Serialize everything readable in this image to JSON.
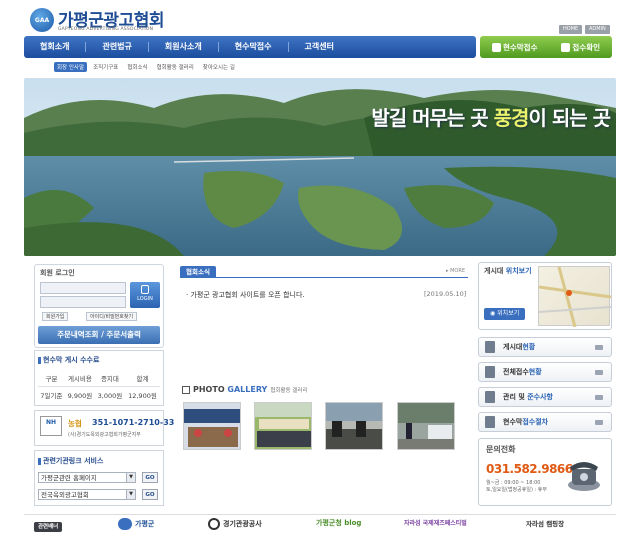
{
  "header": {
    "logo_mark": "GAA",
    "title": "가평군광고협회",
    "subtitle": "GAPYEONG ADVERTISING ASSOCIATION",
    "top_links": [
      "HOME",
      "ADMIN"
    ]
  },
  "nav": {
    "items": [
      "협회소개",
      "관련법규",
      "회원사소개",
      "현수막접수",
      "고객센터"
    ],
    "quick": [
      "현수막접수",
      "접수확인"
    ]
  },
  "sub_nav": [
    "회장 인사말",
    "조직기구표",
    "협회소식",
    "협회활동 갤러리",
    "찾아오시는 길"
  ],
  "banner": {
    "slogan_a": "발길 머무는 곳 ",
    "slogan_b": "풍경",
    "slogan_c": "이 되는 곳"
  },
  "login": {
    "title": "회원 로그인",
    "button": "LOGIN",
    "links": [
      "회원가입",
      "아이디/비밀번호찾기"
    ],
    "order_button": "주문내역조회 / 주문서출력"
  },
  "fee": {
    "title": "현수막 게시 수수료",
    "headers": [
      "구분",
      "게시비용",
      "증지대",
      "합계"
    ],
    "row": [
      "7일기준",
      "9,900원",
      "3,000원",
      "12,900원"
    ]
  },
  "bank": {
    "logo": "NH",
    "name": "농협",
    "account": "351-1071-2710-33",
    "holder": "(사)경기도옥외광고협회가평군지부"
  },
  "related": {
    "title": "관련기관링크 서비스",
    "selects": [
      "가평군관련 홈페이지",
      "전국옥외광고협회"
    ],
    "go": "GO"
  },
  "notice": {
    "tab": "협회소식",
    "more": "MORE",
    "items": [
      {
        "title": "가평군 광고협회 사이트를 오픈 합니다.",
        "date": "[2019.05.10]"
      }
    ]
  },
  "gallery": {
    "title_a": "PHOTO ",
    "title_b": "GALLERY",
    "subtitle": "협회활동 갤러리"
  },
  "map": {
    "title_a": "게시대 ",
    "title_b": "위치보기",
    "button": "위치보기"
  },
  "side_buttons": [
    {
      "a": "게시대",
      "b": "현황"
    },
    {
      "a": "전체접수",
      "b": "현황"
    },
    {
      "a": "관리 및 ",
      "b": "준수사항"
    },
    {
      "a": "현수막",
      "b": "접수절차"
    }
  ],
  "contact": {
    "title": "문의전화",
    "number": "031.582.9866",
    "hours_1": "월~금 : 09:00 ~ 18:00",
    "hours_2": "토,일요일(법정공휴일) : 휴무"
  },
  "footer": {
    "label": "관련배너",
    "links": [
      "가평군",
      "경기관광공사",
      "가평군청 blog",
      "자라섬 국제재즈페스티벌",
      "자라섬 캠핑장"
    ]
  },
  "colors": {
    "brand_blue": "#1e4d95",
    "nav_blue": "#2c5fae",
    "quick_green": "#6cb232",
    "phone_orange": "#e05a14"
  }
}
